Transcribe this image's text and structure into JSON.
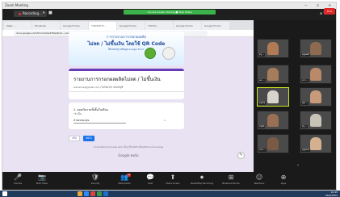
{
  "window": {
    "title": "Zoom Meeting",
    "controls": "— ☐ ✕"
  },
  "top_bar": {
    "recording_label": "Recording...",
    "share_banner": "You are screen sharing  ■ Stop Share",
    "view_label": "⊞ View"
  },
  "browser": {
    "tabs": [
      "Meet - ...",
      "Facebook",
      "Google Forms",
      "รายงานการ...",
      "Google Forms",
      "รายงาน...",
      "Google Forms",
      "Google Forms"
    ],
    "url": "docs.google.com/forms/d/e/1FAIpQLSc.../viewform"
  },
  "form": {
    "header_line1": "การรายงานการกรอกผลผลิต",
    "header_line2": "ไม่ลด / ไม่ขึ้นเงิน โดยใช้ QR Code",
    "header_line3": "ฝึกอบรมฐานข้อมูล Google Form",
    "title": "รายงานการกรอกผลผลิตไม่ลด / ไม่ขึ้นเงิน",
    "account": "someone@gmail.com  (ไม่ได้แชร์)   สลับบัญชี",
    "question_label": "1. ยอดเงินรวมทั้งสิ้นในเดือน",
    "question_hint": "*จำเป็น",
    "answer_value": "คำตอบของคุณ",
    "counter": "1",
    "back_label": "กลับ",
    "next_label": "ถัดไป",
    "footer_note": "ห้ามส่งรหัสผ่านใน Google ฟอร์ม  เนื้อหานี้ไม่ได้สร้างขึ้นหรือรับรองโดย Google",
    "brand": "Google ฟอร์ม"
  },
  "participants": [
    {
      "name": "ครู ...",
      "color": "#b07a55"
    },
    {
      "name": "ครูสมศรี",
      "color": "#8d6a50"
    },
    {
      "name": "ผอ. ...",
      "color": "#a57c5c"
    },
    {
      "name": "นาง ...",
      "color": "#b88a6a"
    },
    {
      "name": "ครูวิไล",
      "color": "#d8d4cc"
    },
    {
      "name": "คุณ ...",
      "color": "#c79b7a"
    },
    {
      "name": "ครูนิด",
      "color": "#9a7054"
    },
    {
      "name": "ครู ...",
      "color": "#c9c2b6"
    },
    {
      "name": "นาย ...",
      "color": "#7a5a44"
    },
    {
      "name": "ครูจันทร์",
      "color": "#d4b08f"
    }
  ],
  "toolbar": {
    "items": [
      {
        "label": "Unmute",
        "icon": "🎤"
      },
      {
        "label": "Start Video",
        "icon": "📷"
      },
      {
        "label": "Security",
        "icon": "🛡"
      },
      {
        "label": "Participants",
        "icon": "👥",
        "badge": "14"
      },
      {
        "label": "Chat",
        "icon": "💬"
      },
      {
        "label": "Share Screen",
        "icon": "⬆"
      },
      {
        "label": "Pause/Stop Recording",
        "icon": "⏺"
      },
      {
        "label": "Breakout Rooms",
        "icon": "⊞"
      },
      {
        "label": "Reactions",
        "icon": "☺"
      },
      {
        "label": "Apps",
        "icon": "⊕"
      }
    ],
    "end_label": "End"
  },
  "taskbar": {
    "time": "10:45",
    "date": "16/6/2564"
  }
}
